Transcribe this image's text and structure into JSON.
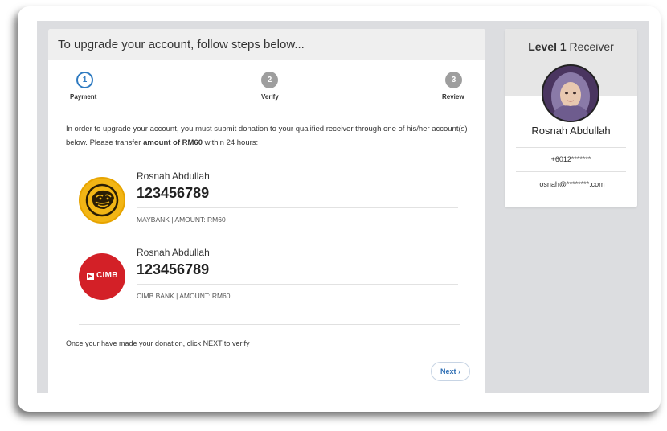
{
  "main": {
    "header": "To upgrade your account, follow steps below...",
    "steps": [
      {
        "number": "1",
        "label": "Payment"
      },
      {
        "number": "2",
        "label": "Verify"
      },
      {
        "number": "3",
        "label": "Review"
      }
    ],
    "instructions_pre": "In order to upgrade your account, you must submit donation to your qualified receiver through one of his/her account(s) below. Please transfer ",
    "instructions_bold": "amount of RM60",
    "instructions_post": " within 24 hours:",
    "accounts": [
      {
        "name": "Rosnah Abdullah",
        "number": "123456789",
        "meta": "MAYBANK | AMOUNT: RM60",
        "logo_icon": "maybank-tiger-logo",
        "logo_color": "#f2b515"
      },
      {
        "name": "Rosnah Abdullah",
        "number": "123456789",
        "meta": "CIMB BANK | AMOUNT: RM60",
        "logo_icon": "cimb-logo",
        "logo_color": "#d32027",
        "logo_text": "CIMB"
      }
    ],
    "note": "Once your have made your donation, click NEXT to verify",
    "next_label": "Next ›"
  },
  "receiver": {
    "level_bold": "Level 1",
    "level_rest": " Receiver",
    "name": "Rosnah Abdullah",
    "phone": "+6012*******",
    "email": "rosnah@********.com"
  },
  "colors": {
    "accent": "#2f7bc1",
    "canvas": "#dcdde0"
  }
}
